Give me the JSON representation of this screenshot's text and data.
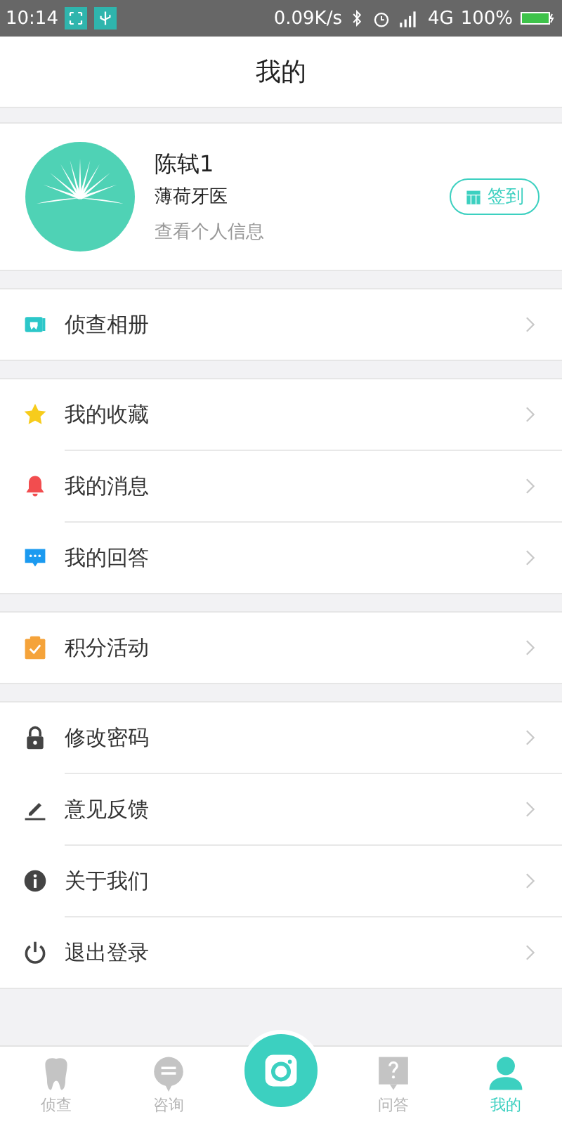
{
  "status_bar": {
    "time": "10:14",
    "speed": "0.09K/s",
    "network": "4G",
    "battery": "100%"
  },
  "header": {
    "title": "我的"
  },
  "profile": {
    "name": "陈轼1",
    "org": "薄荷牙医",
    "link": "查看个人信息",
    "checkin": "签到"
  },
  "menu_groups": [
    [
      {
        "kind": "album",
        "label": "侦查相册"
      }
    ],
    [
      {
        "kind": "star",
        "label": "我的收藏"
      },
      {
        "kind": "bell",
        "label": "我的消息"
      },
      {
        "kind": "chat",
        "label": "我的回答"
      }
    ],
    [
      {
        "kind": "calendar",
        "label": "积分活动"
      }
    ],
    [
      {
        "kind": "lock",
        "label": "修改密码"
      },
      {
        "kind": "pen",
        "label": "意见反馈"
      },
      {
        "kind": "info",
        "label": "关于我们"
      },
      {
        "kind": "power",
        "label": "退出登录"
      }
    ]
  ],
  "tab_bar": [
    {
      "kind": "tooth",
      "label": "侦查",
      "selected": false
    },
    {
      "kind": "chat",
      "label": "咨询",
      "selected": false
    },
    {
      "kind": "camera",
      "selected": false
    },
    {
      "kind": "question",
      "label": "问答",
      "selected": false
    },
    {
      "kind": "person",
      "label": "我的",
      "selected": true
    }
  ]
}
